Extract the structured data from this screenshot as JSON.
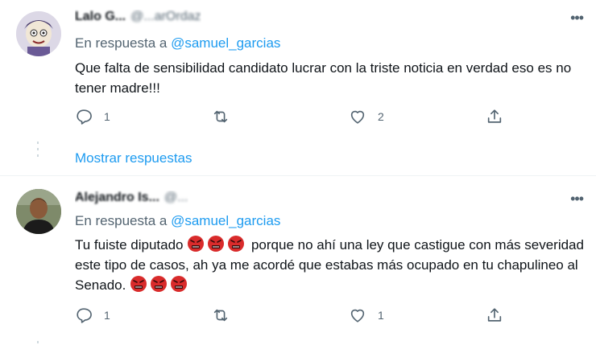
{
  "tweets": [
    {
      "author_name": "Lalo G...",
      "author_handle": "@...arOrdaz",
      "reply_prefix": "En respuesta a",
      "reply_mention": "@samuel_garcias",
      "text": "Que falta de sensibilidad candidato lucrar con la triste noticia en verdad eso es no tener madre!!!",
      "replies": "1",
      "retweets": "",
      "likes": "2",
      "more_icon": "more-icon"
    },
    {
      "author_name": "Alejandro Is...",
      "author_handle": "@...",
      "reply_prefix": "En respuesta a",
      "reply_mention": "@samuel_garcias",
      "text_parts": [
        "Tu fuiste diputado ",
        " porque no ahí una ley que castigue con más severidad este tipo de casos, ah ya me acordé que estabas más ocupado en tu chapulineo al Senado. "
      ],
      "replies": "1",
      "retweets": "",
      "likes": "1"
    }
  ],
  "show_replies": "Mostrar respuestas",
  "colors": {
    "accent": "#1d9bf0",
    "secondary": "#536471",
    "text": "#0f1419",
    "angry": "#d92b2b"
  },
  "icons": [
    "reply-icon",
    "retweet-icon",
    "like-icon",
    "share-icon",
    "angry-face-icon"
  ]
}
